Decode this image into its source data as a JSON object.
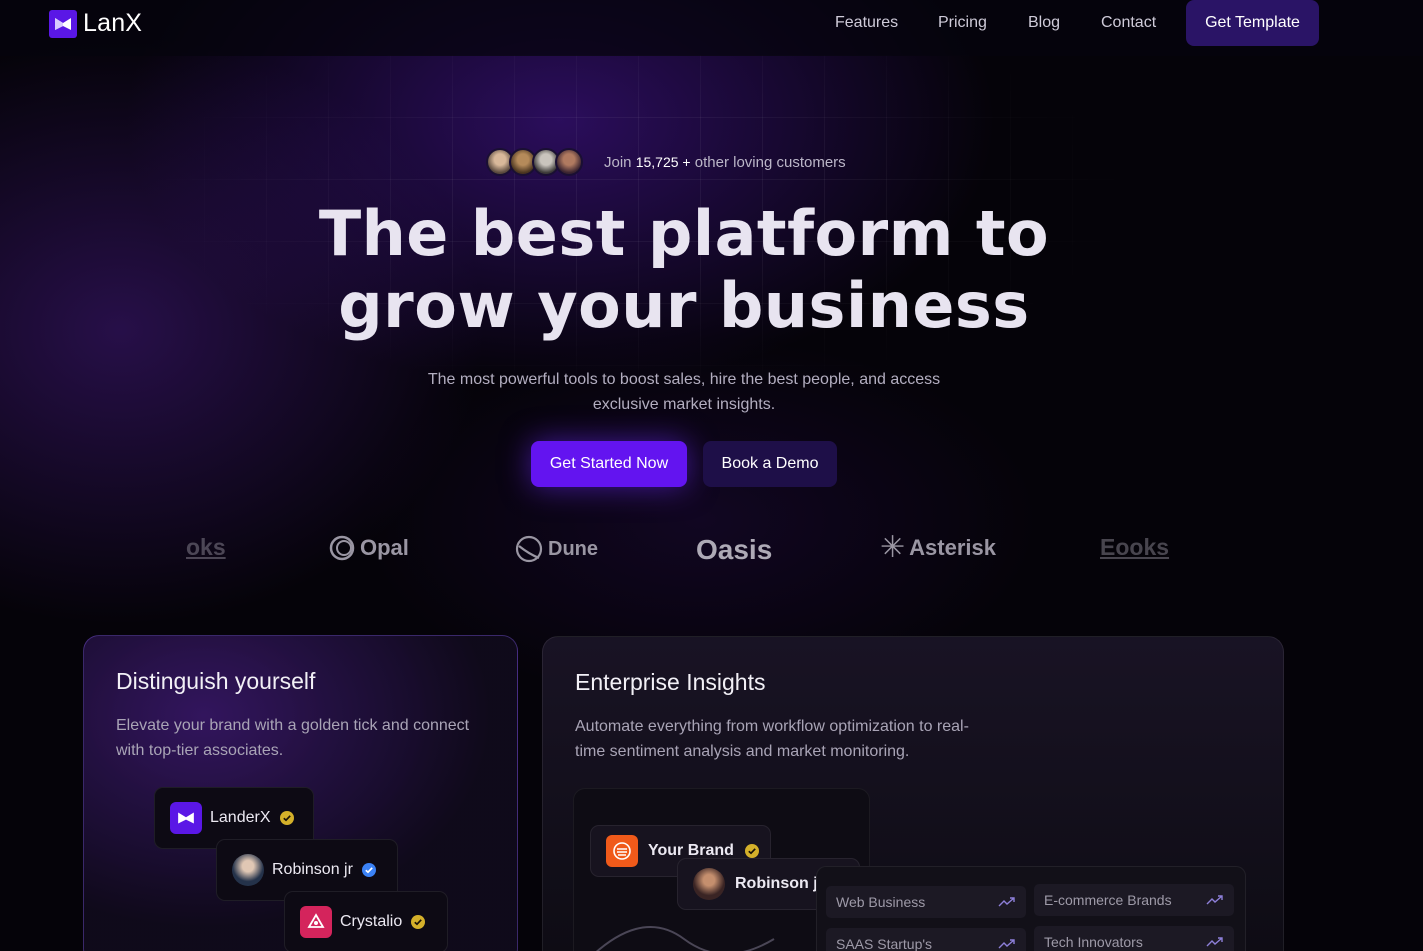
{
  "nav": {
    "brand": "LanX",
    "links": [
      "Features",
      "Pricing",
      "Blog",
      "Contact"
    ],
    "cta": "Get Template"
  },
  "hero": {
    "social_prefix": "Join",
    "social_count": "15,725 +",
    "social_suffix": "other loving customers",
    "title_line1": "The best platform to",
    "title_line2": "grow your business",
    "subtitle": "The most powerful tools to boost sales, hire the best people, and access exclusive market insights.",
    "primary_cta": "Get Started Now",
    "secondary_cta": "Book a Demo"
  },
  "logos": [
    "oks",
    "Opal",
    "Dune",
    "Oasis",
    "Asterisk",
    "Eooks"
  ],
  "card_left": {
    "title": "Distinguish yourself",
    "description": "Elevate your brand with a golden tick and connect with top-tier associates.",
    "chips": [
      "LanderX",
      "Robinson jr",
      "Crystalio"
    ]
  },
  "card_right": {
    "title": "Enterprise Insights",
    "description": "Automate everything from workflow optimization to real-time sentiment analysis and market monitoring.",
    "chips": [
      "Your Brand",
      "Robinson jr"
    ],
    "metrics": [
      "Web Business",
      "E-commerce Brands",
      "SAAS Startup's",
      "Tech Innovators"
    ]
  },
  "colors": {
    "accent": "#6314f0",
    "nav_cta_bg": "#2a1466",
    "gold_tick": "#d4b02a",
    "blue_tick": "#3b82f6"
  }
}
